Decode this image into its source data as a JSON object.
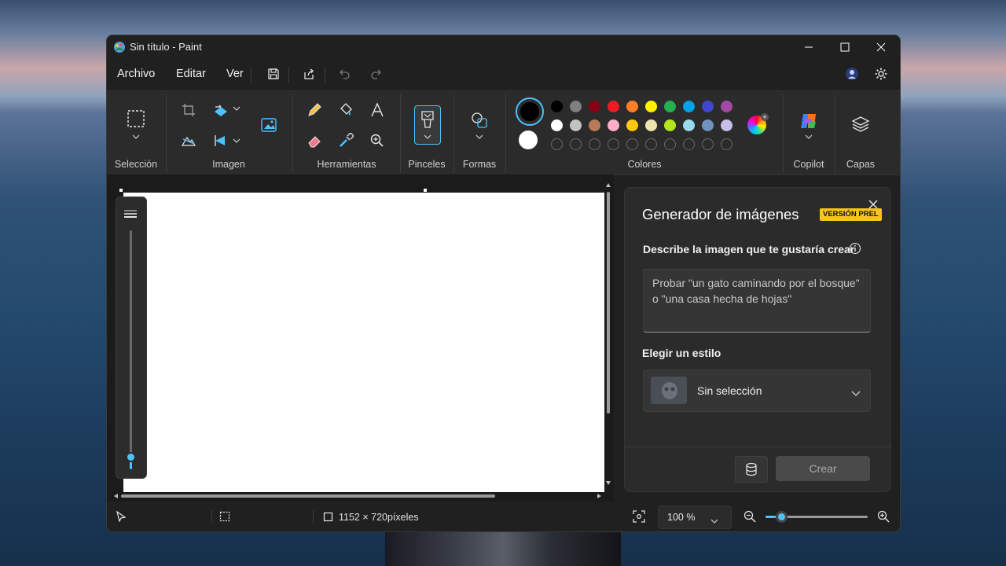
{
  "window": {
    "title": "Sin título - Paint"
  },
  "menu": {
    "archivo": "Archivo",
    "editar": "Editar",
    "ver": "Ver"
  },
  "ribbon": {
    "seleccion": "Selección",
    "imagen": "Imagen",
    "herramientas": "Herramientas",
    "pinceles": "Pinceles",
    "formas": "Formas",
    "colores": "Colores",
    "copilot": "Copilot",
    "capas": "Capas"
  },
  "colors": {
    "primary": "#000000",
    "secondary": "#ffffff",
    "row1": [
      "#000000",
      "#7f7f7f",
      "#880015",
      "#ed1c24",
      "#ff7f27",
      "#fff200",
      "#22b14c",
      "#00a2e8",
      "#3f48cc",
      "#a349a4"
    ],
    "row2": [
      "#ffffff",
      "#c3c3c3",
      "#b97a57",
      "#ffaec9",
      "#ffc90e",
      "#efe4b0",
      "#b5e61d",
      "#99d9ea",
      "#7092be",
      "#c8bfe7"
    ],
    "accent": "#4cc2ff"
  },
  "generator": {
    "title": "Generador de imágenes",
    "badge": "VERSIÓN PREL",
    "prompt_label": "Describe la imagen que te gustaría crear",
    "placeholder_line1": "Probar \"un gato caminando por el bosque\"",
    "placeholder_line2": "o \"una casa hecha de hojas\"",
    "style_label": "Elegir un estilo",
    "style_value": "Sin selección",
    "create_button": "Crear"
  },
  "status": {
    "canvas_size": "1152 × 720píxeles",
    "zoom": "100 %",
    "zoom_level": 0.15
  }
}
